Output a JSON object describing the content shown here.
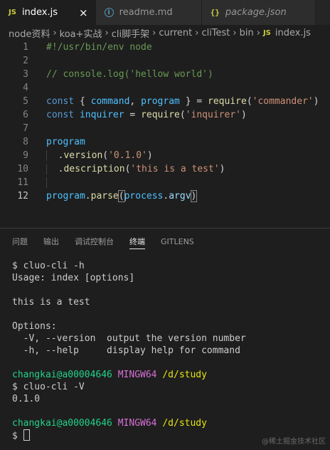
{
  "tabs": [
    {
      "icon": "JS",
      "label": "index.js",
      "close": "×"
    },
    {
      "label": "readme.md"
    },
    {
      "icon": "{}",
      "label": "package.json"
    }
  ],
  "breadcrumb": [
    "node资料",
    "koa+实战",
    "cli脚手架",
    "current",
    "cliTest",
    "bin",
    "index.js"
  ],
  "breadcrumb_sep": "›",
  "breadcrumb_js": "JS",
  "code": {
    "ln": [
      "1",
      "2",
      "3",
      "4",
      "5",
      "6",
      "7",
      "8",
      "9",
      "10",
      "11",
      "12"
    ],
    "l1": "#!/usr/bin/env node",
    "l3": "// console.log('hellow world')",
    "l5": {
      "const": "const",
      "open": "{ ",
      "command": "command",
      "comma": ", ",
      "program": "program",
      "close": " } = ",
      "require": "require",
      "lp": "(",
      "arg": "'commander'",
      "rp": ")"
    },
    "l6": {
      "const": "const",
      "inquirer": "inquirer",
      "eq": " = ",
      "require": "require",
      "lp": "(",
      "arg": "'inquirer'",
      "rp": ")"
    },
    "l8": "program",
    "l9": {
      "dot": ".",
      "fn": "version",
      "lp": "(",
      "arg": "'0.1.0'",
      "rp": ")"
    },
    "l10": {
      "dot": ".",
      "fn": "description",
      "lp": "(",
      "arg": "'this is a test'",
      "rp": ")"
    },
    "l12": {
      "program": "program",
      "dot": ".",
      "fn": "parse",
      "lp": "(",
      "process": "process",
      "dot2": ".",
      "argv": "argv",
      "rp": ")"
    }
  },
  "panel": {
    "tabs": [
      "问题",
      "输出",
      "调试控制台",
      "终端",
      "GITLENS"
    ],
    "active": "终端"
  },
  "terminal": {
    "l1": "$ cluo-cli -h",
    "l2": "Usage: index [options]",
    "l4": "this is a test",
    "l6": "Options:",
    "l7": "  -V, --version  output the version number",
    "l8": "  -h, --help     display help for command",
    "user": "changkai@a00004646",
    "host": "MINGW64",
    "path": "/d/study",
    "l11": "$ cluo-cli -V",
    "l12": "0.1.0",
    "prompt": "$ "
  },
  "watermark": "@稀土掘金技术社区",
  "colors": {
    "editor_bg": "#1e1e1e",
    "tab_bg": "#2d2d2d",
    "terminal_green": "#23d18b",
    "terminal_magenta": "#d670d6",
    "terminal_yellow": "#e5e510"
  }
}
